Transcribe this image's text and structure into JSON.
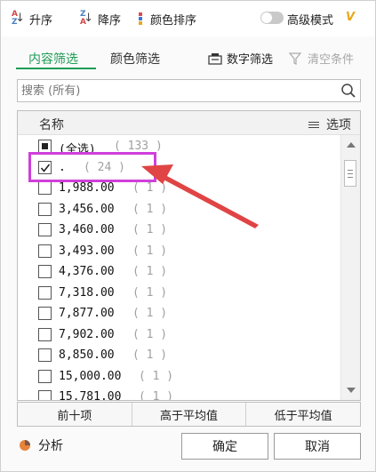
{
  "toolbar": {
    "sort_asc_label": "升序",
    "sort_desc_label": "降序",
    "color_sort_label": "颜色排序",
    "advanced_mode_label": "高级模式",
    "advanced_mode_on": false,
    "vip_badge": "V",
    "colors": {
      "accent": "#1e9c56",
      "vip": "#e8a81c"
    }
  },
  "tabs": {
    "content_filter": "内容筛选",
    "color_filter": "颜色筛选",
    "number_filter": "数字筛选",
    "clear_conditions": "清空条件"
  },
  "search": {
    "placeholder": "搜索 (所有)"
  },
  "list": {
    "header_name": "名称",
    "header_options": "选项",
    "rows": [
      {
        "label": "(全选)",
        "count": "( 133 )",
        "state": "partial"
      },
      {
        "label": ".",
        "count": "( 24 )",
        "state": "checked"
      },
      {
        "label": "1,988.00",
        "count": "( 1 )",
        "state": "unchecked"
      },
      {
        "label": "3,456.00",
        "count": "( 1 )",
        "state": "unchecked"
      },
      {
        "label": "3,460.00",
        "count": "( 1 )",
        "state": "unchecked"
      },
      {
        "label": "3,493.00",
        "count": "( 1 )",
        "state": "unchecked"
      },
      {
        "label": "4,376.00",
        "count": "( 1 )",
        "state": "unchecked"
      },
      {
        "label": "7,318.00",
        "count": "( 1 )",
        "state": "unchecked"
      },
      {
        "label": "7,877.00",
        "count": "( 1 )",
        "state": "unchecked"
      },
      {
        "label": "7,902.00",
        "count": "( 1 )",
        "state": "unchecked"
      },
      {
        "label": "8,850.00",
        "count": "( 1 )",
        "state": "unchecked"
      },
      {
        "label": "15,000.00",
        "count": "( 1 )",
        "state": "unchecked"
      },
      {
        "label": "15,781.00",
        "count": "( 1 )",
        "state": "unchecked"
      }
    ]
  },
  "quick": {
    "top_ten": "前十项",
    "above_average": "高于平均值",
    "below_average": "低于平均值"
  },
  "footer": {
    "analysis_label": "分析",
    "ok_label": "确定",
    "cancel_label": "取消"
  }
}
